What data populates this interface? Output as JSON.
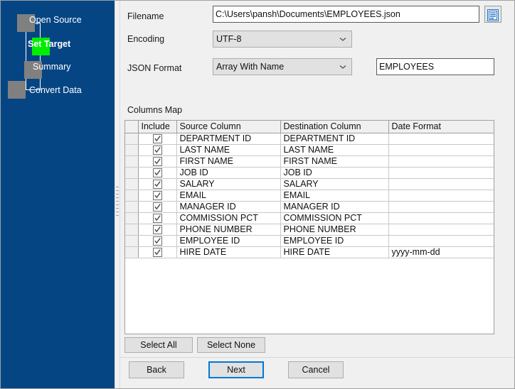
{
  "wizard": {
    "steps": [
      {
        "label": "Open Source",
        "state": "done"
      },
      {
        "label": "Set Target",
        "state": "active"
      },
      {
        "label": "Summary",
        "state": "pending"
      },
      {
        "label": "Convert Data",
        "state": "pending"
      }
    ],
    "active_color": "#00ee00",
    "node_color": "#808080",
    "panel_color": "#064584"
  },
  "form": {
    "filename_label": "Filename",
    "filename_value": "C:\\Users\\pansh\\Documents\\EMPLOYEES.json",
    "filename_placeholder": "",
    "browse_icon": "document-icon",
    "encoding_label": "Encoding",
    "encoding_value": "UTF-8",
    "json_format_label": "JSON Format",
    "json_format_value": "Array With Name",
    "array_name_value": "EMPLOYEES",
    "array_name_placeholder": ""
  },
  "columns_map": {
    "title": "Columns Map",
    "headers": [
      "",
      "Include",
      "Source Column",
      "Destination Column",
      "Date Format"
    ],
    "rows": [
      {
        "include": true,
        "source": "DEPARTMENT ID",
        "destination": "DEPARTMENT ID",
        "date_format": ""
      },
      {
        "include": true,
        "source": "LAST NAME",
        "destination": "LAST NAME",
        "date_format": ""
      },
      {
        "include": true,
        "source": "FIRST NAME",
        "destination": "FIRST NAME",
        "date_format": ""
      },
      {
        "include": true,
        "source": "JOB ID",
        "destination": "JOB ID",
        "date_format": ""
      },
      {
        "include": true,
        "source": "SALARY",
        "destination": "SALARY",
        "date_format": ""
      },
      {
        "include": true,
        "source": "EMAIL",
        "destination": "EMAIL",
        "date_format": ""
      },
      {
        "include": true,
        "source": "MANAGER ID",
        "destination": "MANAGER ID",
        "date_format": ""
      },
      {
        "include": true,
        "source": "COMMISSION PCT",
        "destination": "COMMISSION PCT",
        "date_format": ""
      },
      {
        "include": true,
        "source": "PHONE NUMBER",
        "destination": "PHONE NUMBER",
        "date_format": ""
      },
      {
        "include": true,
        "source": "EMPLOYEE ID",
        "destination": "EMPLOYEE ID",
        "date_format": ""
      },
      {
        "include": true,
        "source": "HIRE DATE",
        "destination": "HIRE DATE",
        "date_format": "yyyy-mm-dd"
      }
    ]
  },
  "selection_buttons": {
    "select_all": "Select All",
    "select_none": "Select None"
  },
  "nav_buttons": {
    "back": "Back",
    "next": "Next",
    "cancel": "Cancel",
    "focus_color": "#0078d7"
  }
}
